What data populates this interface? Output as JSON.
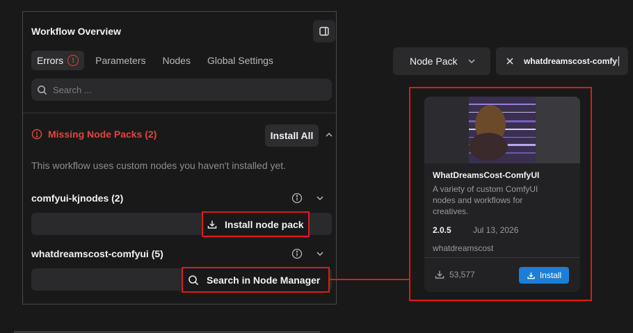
{
  "panel": {
    "title": "Workflow Overview",
    "tabs": [
      {
        "label": "Errors",
        "active": true,
        "badge": "!"
      },
      {
        "label": "Parameters"
      },
      {
        "label": "Nodes"
      },
      {
        "label": "Global Settings"
      }
    ],
    "search_placeholder": "Search ...",
    "missing": {
      "title": "Missing Node Packs (2)",
      "install_all_label": "Install All",
      "description": "This workflow uses custom nodes you haven't installed yet.",
      "packs": [
        {
          "name": "comfyui-kjnodes (2)",
          "action_label": "Install node pack"
        },
        {
          "name": "whatdreamscost-comfyui (5)",
          "action_label": "Search in Node Manager"
        }
      ]
    }
  },
  "manager": {
    "filter_label": "Node Pack",
    "search_value": "whatdreamscost-comfyui",
    "card": {
      "title": "WhatDreamsCost-ComfyUI",
      "description": "A variety of custom ComfyUI nodes and workflows for creatives.",
      "version": "2.0.5",
      "date": "Jul 13, 2026",
      "author": "whatdreamscost",
      "downloads": "53,577",
      "install_label": "Install"
    }
  },
  "colors": {
    "error": "#e0453f",
    "highlight": "#e01a1a",
    "accent": "#1a7fd9"
  }
}
